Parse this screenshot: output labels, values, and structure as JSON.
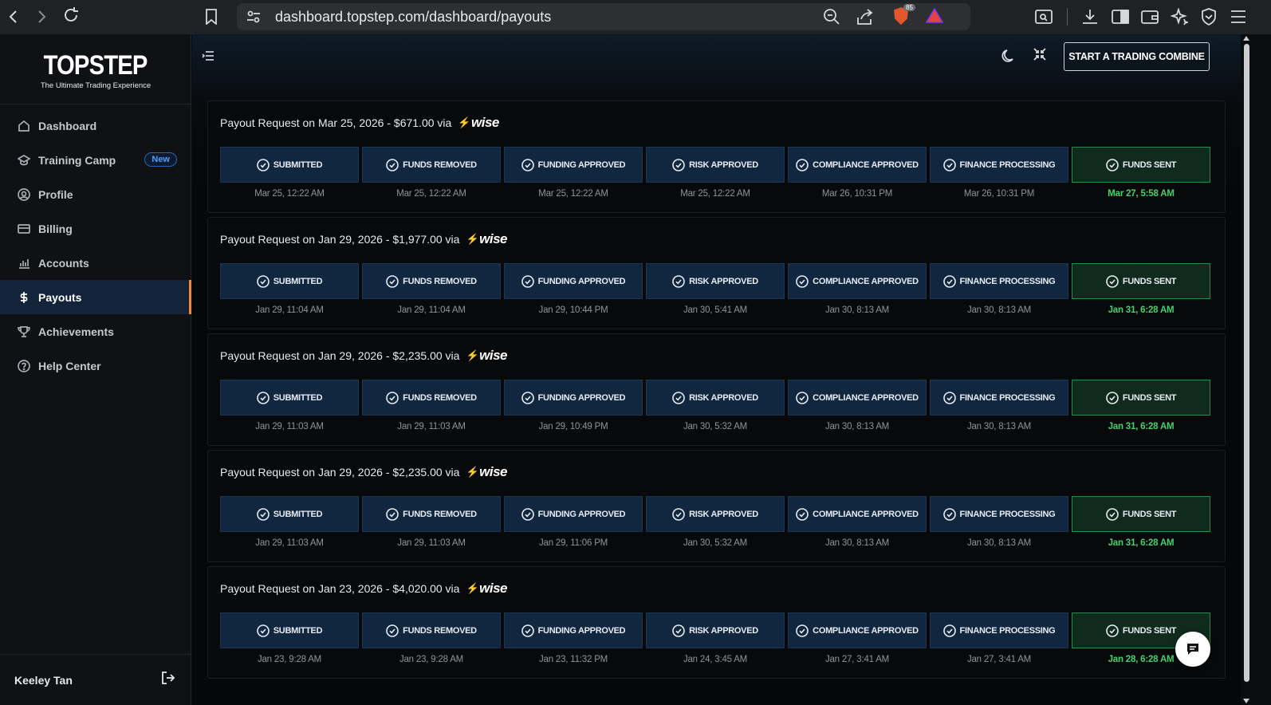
{
  "browser": {
    "url": "dashboard.topstep.com/dashboard/payouts",
    "brave_badge": "85"
  },
  "sidebar": {
    "logo_main": "TOPSTEP",
    "logo_sub": "The Ultimate Trading Experience",
    "items": [
      {
        "label": "Dashboard",
        "icon": "home-icon"
      },
      {
        "label": "Training Camp",
        "icon": "graduation-cap-icon",
        "badge": "New"
      },
      {
        "label": "Profile",
        "icon": "user-circle-icon"
      },
      {
        "label": "Billing",
        "icon": "credit-card-icon"
      },
      {
        "label": "Accounts",
        "icon": "bar-chart-icon"
      },
      {
        "label": "Payouts",
        "icon": "dollar-icon",
        "active": true
      },
      {
        "label": "Achievements",
        "icon": "trophy-icon"
      },
      {
        "label": "Help Center",
        "icon": "help-circle-icon"
      }
    ],
    "user_name": "Keeley Tan"
  },
  "topbar": {
    "cta_label": "START A TRADING COMBINE"
  },
  "step_labels": [
    "SUBMITTED",
    "FUNDS REMOVED",
    "FUNDING APPROVED",
    "RISK APPROVED",
    "COMPLIANCE APPROVED",
    "FINANCE PROCESSING",
    "FUNDS SENT"
  ],
  "payouts": [
    {
      "title": "Payout Request on Mar 25, 2026 - $671.00 via",
      "method": "wise",
      "dates": [
        "Mar 25, 12:22 AM",
        "Mar 25, 12:22 AM",
        "Mar 25, 12:22 AM",
        "Mar 25, 12:22 AM",
        "Mar 26, 10:31 PM",
        "Mar 26, 10:31 PM",
        "Mar 27, 5:58 AM"
      ]
    },
    {
      "title": "Payout Request on Jan 29, 2026 - $1,977.00 via",
      "method": "wise",
      "dates": [
        "Jan 29, 11:04 AM",
        "Jan 29, 11:04 AM",
        "Jan 29, 10:44 PM",
        "Jan 30, 5:41 AM",
        "Jan 30, 8:13 AM",
        "Jan 30, 8:13 AM",
        "Jan 31, 6:28 AM"
      ]
    },
    {
      "title": "Payout Request on Jan 29, 2026 - $2,235.00 via",
      "method": "wise",
      "dates": [
        "Jan 29, 11:03 AM",
        "Jan 29, 11:03 AM",
        "Jan 29, 10:49 PM",
        "Jan 30, 5:32 AM",
        "Jan 30, 8:13 AM",
        "Jan 30, 8:13 AM",
        "Jan 31, 6:28 AM"
      ]
    },
    {
      "title": "Payout Request on Jan 29, 2026 - $2,235.00 via",
      "method": "wise",
      "dates": [
        "Jan 29, 11:03 AM",
        "Jan 29, 11:03 AM",
        "Jan 29, 11:06 PM",
        "Jan 30, 5:32 AM",
        "Jan 30, 8:13 AM",
        "Jan 30, 8:13 AM",
        "Jan 31, 6:28 AM"
      ]
    },
    {
      "title": "Payout Request on Jan 23, 2026 - $4,020.00 via",
      "method": "wise",
      "dates": [
        "Jan 23, 9:28 AM",
        "Jan 23, 9:28 AM",
        "Jan 23, 11:32 PM",
        "Jan 24, 3:45 AM",
        "Jan 27, 3:41 AM",
        "Jan 27, 3:41 AM",
        "Jan 28, 6:28 AM"
      ]
    }
  ],
  "colors": {
    "accent_orange": "#f08a3a",
    "step_blue": "#11263f",
    "step_green": "#102b1d",
    "sent_text": "#45d16e",
    "badge_blue": "#4aa0ff"
  }
}
